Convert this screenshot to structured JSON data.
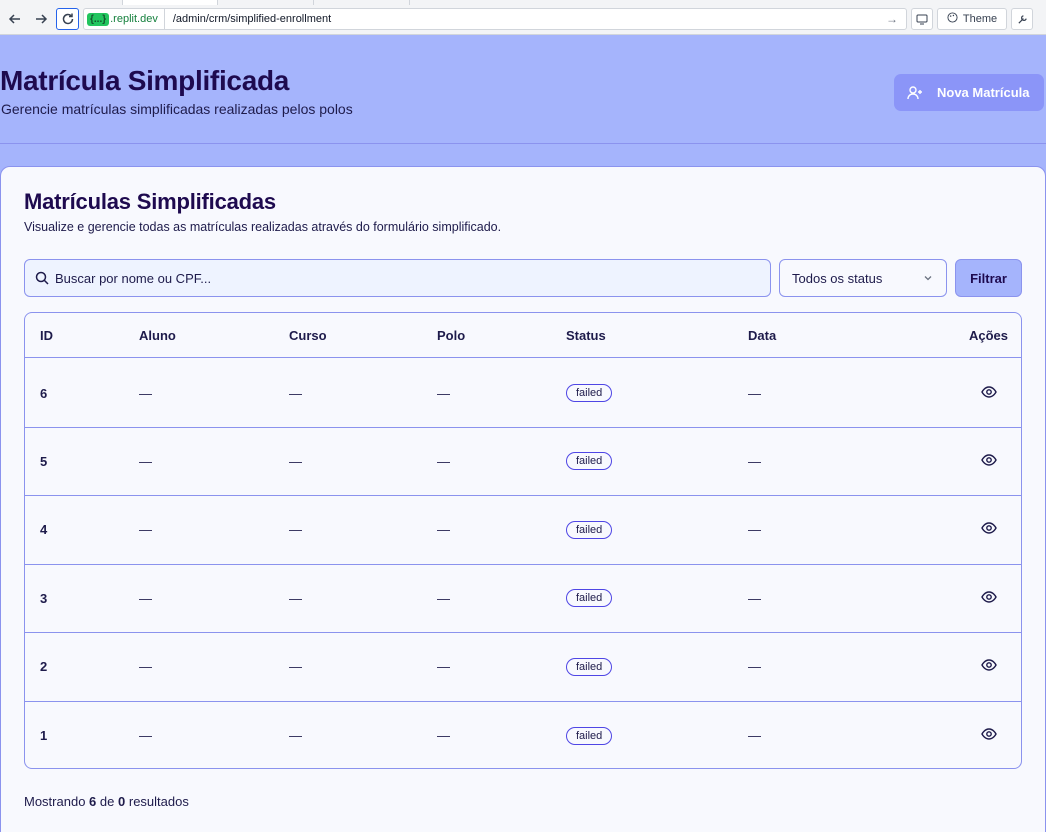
{
  "browser": {
    "host_badge": "{...}",
    "host": ".replit.dev",
    "path": "/admin/crm/simplified-enrollment",
    "theme_label": "Theme"
  },
  "header": {
    "title": "Matrícula Simplificada",
    "subtitle": "Gerencie matrículas simplificadas realizadas pelos polos",
    "new_button": "Nova Matrícula"
  },
  "card": {
    "title": "Matrículas Simplificadas",
    "subtitle": "Visualize e gerencie todas as matrículas realizadas através do formulário simplificado."
  },
  "filters": {
    "search_placeholder": "Buscar por nome ou CPF...",
    "status_selected": "Todos os status",
    "filter_button": "Filtrar"
  },
  "table": {
    "headers": [
      "ID",
      "Aluno",
      "Curso",
      "Polo",
      "Status",
      "Data",
      "Ações"
    ],
    "rows": [
      {
        "id": "6",
        "aluno": "—",
        "curso": "—",
        "polo": "—",
        "status": "failed",
        "data": "—"
      },
      {
        "id": "5",
        "aluno": "—",
        "curso": "—",
        "polo": "—",
        "status": "failed",
        "data": "—"
      },
      {
        "id": "4",
        "aluno": "—",
        "curso": "—",
        "polo": "—",
        "status": "failed",
        "data": "—"
      },
      {
        "id": "3",
        "aluno": "—",
        "curso": "—",
        "polo": "—",
        "status": "failed",
        "data": "—"
      },
      {
        "id": "2",
        "aluno": "—",
        "curso": "—",
        "polo": "—",
        "status": "failed",
        "data": "—"
      },
      {
        "id": "1",
        "aluno": "—",
        "curso": "—",
        "polo": "—",
        "status": "failed",
        "data": "—"
      }
    ]
  },
  "footer": {
    "prefix": "Mostrando",
    "shown": "6",
    "middle": "de",
    "total": "0",
    "suffix": "resultados"
  }
}
